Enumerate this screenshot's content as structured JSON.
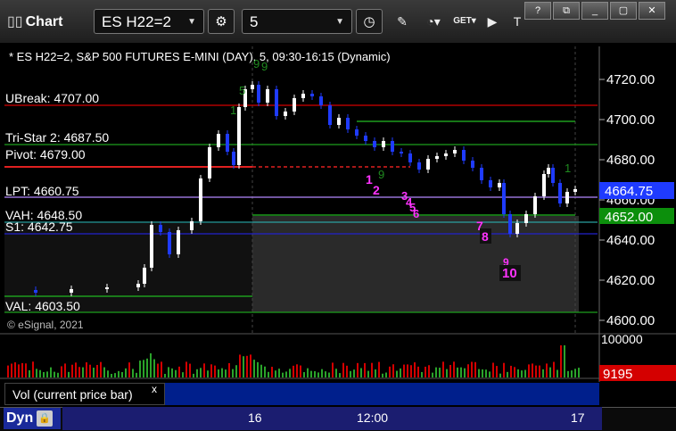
{
  "app": {
    "title": "Chart"
  },
  "toolbar": {
    "symbol": "ES H22=2",
    "interval": "5"
  },
  "chart": {
    "heading": "* ES H22=2, S&P 500 FUTURES E-MINI (DAY), 5, 09:30-16:15 (Dynamic)",
    "copyright": "© eSignal, 2021",
    "level_labels": {
      "ubreak": "UBreak: 4707.00",
      "tristar": "Tri-Star 2: 4687.50",
      "pivot": "Pivot: 4679.00",
      "lpt": "LPT: 4660.75",
      "vah": "VAH: 4648.50",
      "s1": "S1: 4642.75",
      "val": "VAL: 4603.50"
    },
    "price_ticks": [
      "4720.00",
      "4700.00",
      "4680.00",
      "4660.00",
      "4640.00",
      "4620.00",
      "4600.00"
    ],
    "last_price": "4664.75",
    "green_price": "4652.00",
    "volume_tick": "100000",
    "volume_value": "9195",
    "time_labels": [
      "16",
      "12:00",
      "17"
    ],
    "seq_labels": [
      "1",
      "2",
      "3",
      "4",
      "5",
      "6",
      "7",
      "8",
      "9",
      "10"
    ],
    "colors": {
      "up": "#ffffff",
      "down": "#1f3bff",
      "ubreak": "#d40000",
      "pivot": "#e02020",
      "green_line": "#1e9e1e",
      "purple_line": "#b388ff",
      "blue_line": "#2222cc",
      "magenta": "#ff33ff",
      "volume": "#2aa32a"
    }
  },
  "volume_panel": {
    "label": "Vol (current price bar)",
    "close_icon": "x"
  },
  "bottom": {
    "mode": "Dyn"
  }
}
